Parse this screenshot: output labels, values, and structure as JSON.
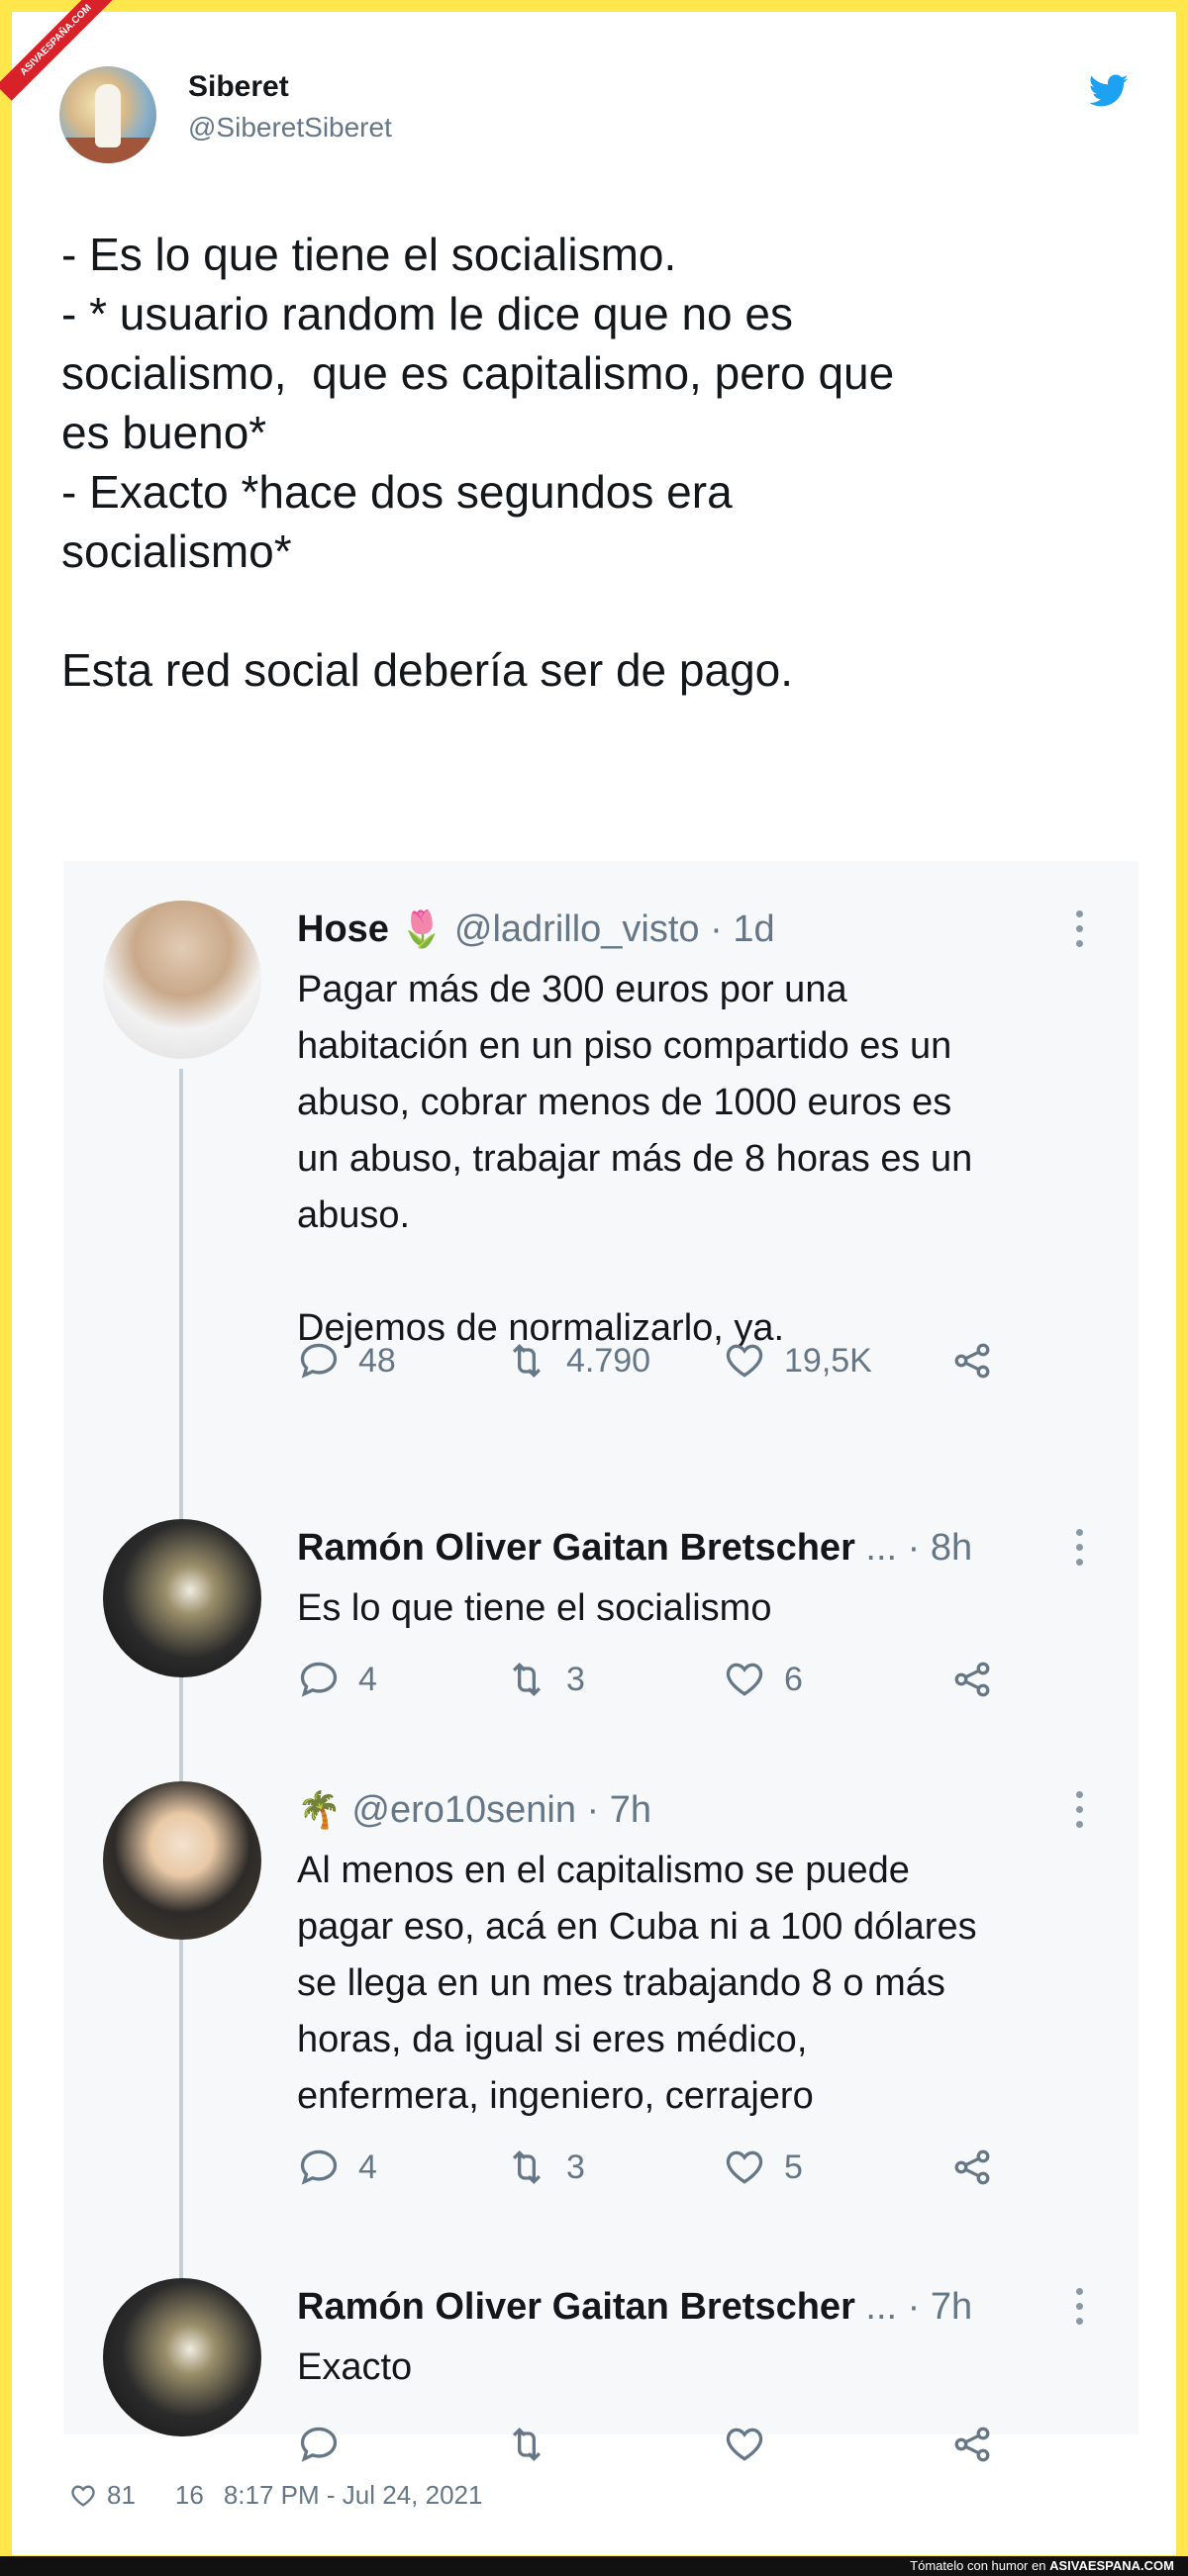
{
  "watermark": {
    "ribbon": "ASIVAESPAÑA.COM",
    "footer_prefix": "Tómatelo con humor en",
    "footer_site": "ASIVAESPANA.COM"
  },
  "tweet": {
    "author_name": "Siberet",
    "author_handle": "@SiberetSiberet",
    "lines": [
      "- Es lo que tiene el socialismo.",
      "- * usuario random le dice que no es",
      "socialismo,  que es capitalismo, pero que",
      "es bueno*",
      "- Exacto *hace dos segundos era",
      "socialismo*"
    ],
    "closing": "Esta red social debería ser de pago.",
    "likes": "81",
    "retweets": "16",
    "timestamp": "8:17 PM - Jul 24, 2021"
  },
  "embedded_thread": [
    {
      "name": "Hose",
      "emoji": "🌷",
      "meta": "@ladrillo_visto · 1d",
      "text": "Pagar más de 300 euros por una\nhabitación en un piso compartido es un\nabuso, cobrar menos de 1000 euros es\nun abuso, trabajar más de 8 horas es un\nabuso.\n\nDejemos de normalizarlo, ya.",
      "replies": "48",
      "retweets": "4.790",
      "likes": "19,5K"
    },
    {
      "name": "Ramón Oliver Gaitan Bretscher",
      "meta": "... · 8h",
      "text": "Es lo que tiene el socialismo",
      "replies": "4",
      "retweets": "3",
      "likes": "6"
    },
    {
      "name": "",
      "emoji": "🌴",
      "meta": "@ero10senin · 7h",
      "text": "Al menos en el capitalismo se puede\npagar eso, acá en Cuba ni a 100 dólares\nse llega en un mes trabajando 8 o más\nhoras, da igual si eres médico,\nenfermera, ingeniero, cerrajero",
      "replies": "4",
      "retweets": "3",
      "likes": "5"
    },
    {
      "name": "Ramón Oliver Gaitan Bretscher",
      "meta": "... · 7h",
      "text": "Exacto",
      "replies": "",
      "retweets": "",
      "likes": ""
    }
  ],
  "icons": {
    "platform": "twitter-bird-icon",
    "reply": "reply-icon",
    "retweet": "retweet-icon",
    "like": "heart-icon",
    "share": "share-icon",
    "more": "more-options-icon"
  },
  "colors": {
    "frame": "#ffe64a",
    "twitter_blue": "#1da1f2",
    "muted": "#657786",
    "thread_line": "#c4cfd6"
  }
}
